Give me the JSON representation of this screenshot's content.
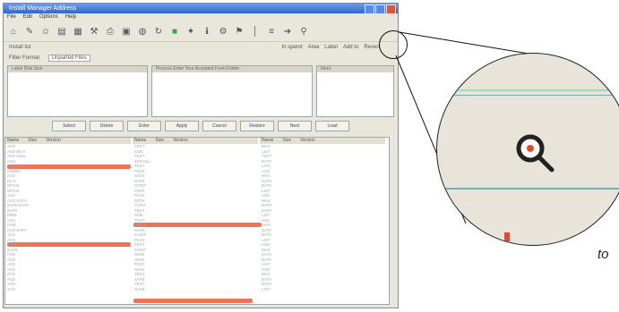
{
  "window": {
    "title": "Install Manager Address"
  },
  "menu": [
    "File",
    "Edit",
    "Options",
    "Help"
  ],
  "toolbar_icons": [
    "open-icon",
    "pen-icon",
    "user-icon",
    "page-icon",
    "grid-icon",
    "wrench-icon",
    "printer-icon",
    "box-icon",
    "globe-icon",
    "refresh-icon",
    "green-icon",
    "star-icon",
    "info-icon",
    "gear-icon",
    "tool-icon",
    "pipe-icon",
    "list-icon",
    "arrow-icon",
    "search-icon"
  ],
  "options": {
    "left1": "Install list",
    "left2": "Filter Format",
    "left2b": "Unparted Files",
    "right": [
      "In spend",
      "Area",
      "Label",
      "Add to",
      "Revert"
    ]
  },
  "panes": [
    {
      "header": "Label     Disk     Size"
    },
    {
      "header": "Process     Enter Your Accepted Form Folder"
    },
    {
      "header": "Ident"
    }
  ],
  "buttons": [
    "Select",
    "Delete",
    "Enter",
    "Apply",
    "Cancel",
    "Restore",
    "Next",
    "Load"
  ],
  "columns": [
    {
      "headers": [
        "Name",
        "Size",
        "Version"
      ],
      "rows": [
        "ACE",
        "ACE MAX",
        "ACE Data",
        "ACE",
        "ACE Form",
        "ADMIN",
        "ACE",
        "IIS S",
        "SPICE",
        "SPICE",
        "ACE",
        "ACE DATA",
        "SAFE DATA",
        "SAFE",
        "MEM",
        "ACE",
        "CMD",
        "ACE DATA",
        "ACE",
        "ACE",
        "SAFE",
        "SAFE",
        "ACE",
        "ACE",
        "ACE",
        "ACE",
        "ACE",
        "ACE",
        "ACE",
        "ACE"
      ]
    },
    {
      "headers": [
        "Name",
        "Size",
        "Version"
      ],
      "rows": [
        "TEST",
        "SIZE",
        "TEST",
        "INSTALL",
        "TEST",
        "PACK",
        "SIGN",
        "SAFE",
        "CONT",
        "TEST",
        "PACK",
        "SIGN",
        "CONT",
        "TEST",
        "SIZE",
        "TEST",
        "CONT",
        "SAFE",
        "CONT",
        "PACK",
        "TEST",
        "CONT",
        "SIGN",
        "SIGN",
        "TEST",
        "SIGN",
        "TEST",
        "SAFE",
        "TEST",
        "SAFE"
      ]
    },
    {
      "headers": [
        "Name",
        "Size",
        "Version"
      ],
      "rows": [
        "MAX",
        "LIST",
        "TEST",
        "DATA",
        "LIST",
        "ACE",
        "MAX",
        "DATA",
        "DATA",
        "LIST",
        "ACE",
        "MAX",
        "DATA",
        "DATA",
        "LIST",
        "ACE",
        "MAX",
        "DATA",
        "DATA",
        "LIST",
        "ACE",
        "MAX",
        "DATA",
        "DATA",
        "LIST",
        "ACE",
        "MAX",
        "DATA",
        "DATA",
        "LIST"
      ]
    }
  ],
  "caption": "to"
}
